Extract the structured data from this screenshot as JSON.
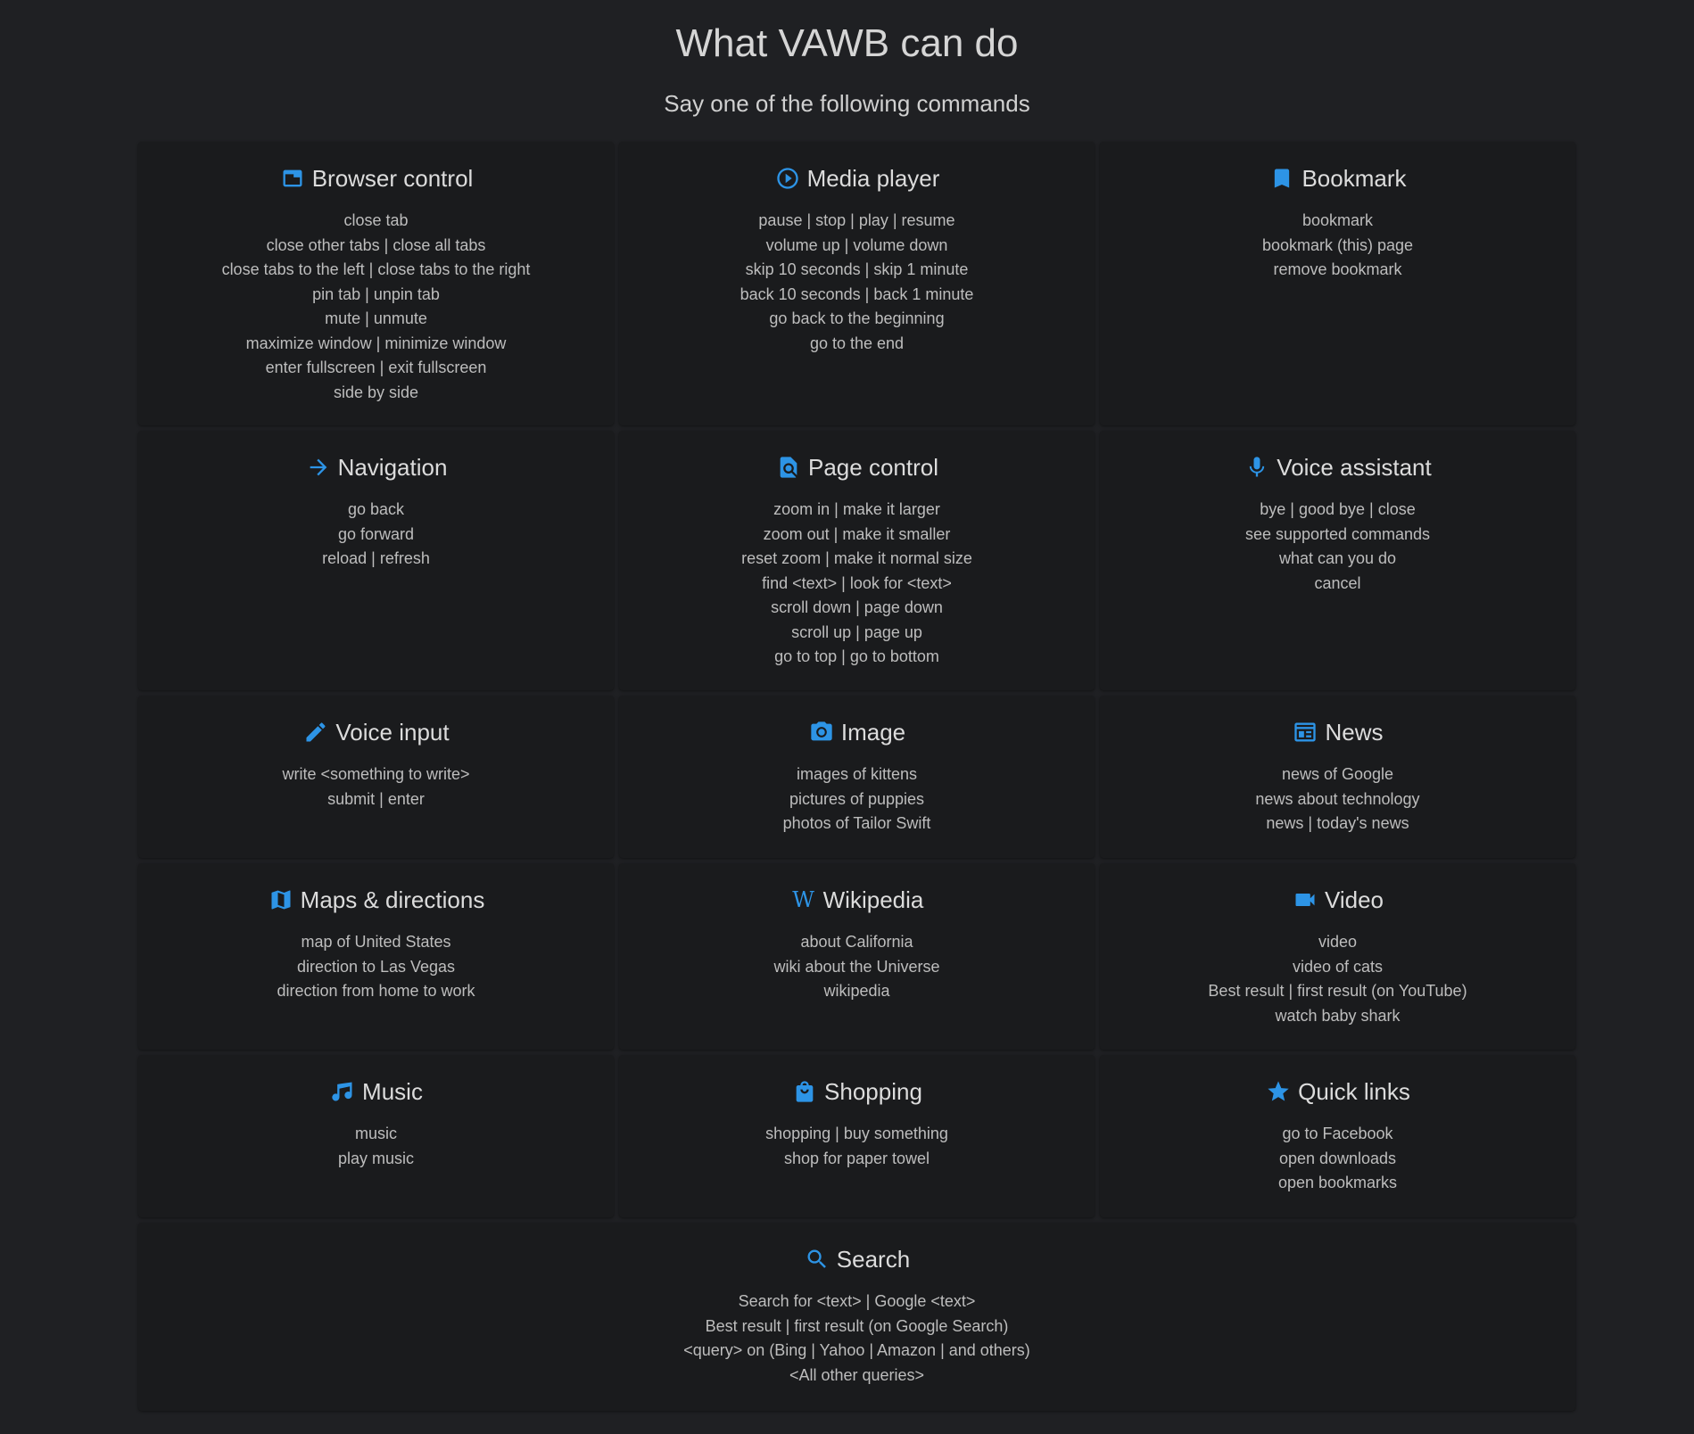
{
  "page": {
    "title": "What VAWB can do",
    "subtitle": "Say one of the following commands"
  },
  "icon_color": "#2d94e6",
  "sections": [
    {
      "title": "Browser control",
      "icon": "browser-window-icon",
      "commands": [
        "close tab",
        "close other tabs | close all tabs",
        "close tabs to the left | close tabs to the right",
        "pin tab | unpin tab",
        "mute | unmute",
        "maximize window | minimize window",
        "enter fullscreen | exit fullscreen",
        "side by side"
      ]
    },
    {
      "title": "Media player",
      "icon": "play-circle-icon",
      "commands": [
        "pause | stop | play | resume",
        "volume up | volume down",
        "skip 10 seconds | skip 1 minute",
        "back 10 seconds | back 1 minute",
        "go back to the beginning",
        "go to the end"
      ]
    },
    {
      "title": "Bookmark",
      "icon": "bookmark-icon",
      "commands": [
        "bookmark",
        "bookmark (this) page",
        "remove bookmark"
      ]
    },
    {
      "title": "Navigation",
      "icon": "arrow-right-icon",
      "commands": [
        "go back",
        "go forward",
        "reload | refresh"
      ]
    },
    {
      "title": "Page control",
      "icon": "find-in-page-icon",
      "commands": [
        "zoom in | make it larger",
        "zoom out | make it smaller",
        "reset zoom | make it normal size",
        "find <text> | look for <text>",
        "scroll down | page down",
        "scroll up | page up",
        "go to top | go to bottom"
      ]
    },
    {
      "title": "Voice assistant",
      "icon": "microphone-icon",
      "commands": [
        "bye | good bye | close",
        "see supported commands",
        "what can you do",
        "cancel"
      ]
    },
    {
      "title": "Voice input",
      "icon": "pencil-icon",
      "commands": [
        "write <something to write>",
        "submit | enter"
      ]
    },
    {
      "title": "Image",
      "icon": "camera-icon",
      "commands": [
        "images of kittens",
        "pictures of puppies",
        "photos of Tailor Swift"
      ]
    },
    {
      "title": "News",
      "icon": "newspaper-icon",
      "commands": [
        "news of Google",
        "news about technology",
        "news | today's news"
      ]
    },
    {
      "title": "Maps & directions",
      "icon": "map-icon",
      "commands": [
        "map of United States",
        "direction to Las Vegas",
        "direction from home to work"
      ]
    },
    {
      "title": "Wikipedia",
      "icon": "wikipedia-icon",
      "commands": [
        "about California",
        "wiki about the Universe",
        "wikipedia"
      ]
    },
    {
      "title": "Video",
      "icon": "videocam-icon",
      "commands": [
        "video",
        "video of cats",
        "Best result | first result (on YouTube)",
        "watch baby shark"
      ]
    },
    {
      "title": "Music",
      "icon": "music-note-icon",
      "commands": [
        "music",
        "play music"
      ]
    },
    {
      "title": "Shopping",
      "icon": "shopping-bag-icon",
      "commands": [
        "shopping | buy something",
        "shop for paper towel"
      ]
    },
    {
      "title": "Quick links",
      "icon": "star-icon",
      "commands": [
        "go to Facebook",
        "open downloads",
        "open bookmarks"
      ]
    },
    {
      "title": "Search",
      "icon": "search-icon",
      "commands": [
        "Search for <text> | Google <text>",
        "Best result | first result (on Google Search)",
        "<query> on (Bing | Yahoo | Amazon | and others)",
        "<All other queries>"
      ]
    }
  ]
}
